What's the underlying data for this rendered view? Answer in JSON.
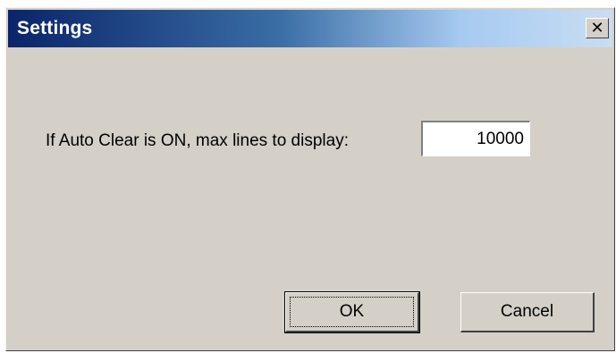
{
  "window": {
    "title": "Settings"
  },
  "form": {
    "prompt": "If Auto Clear is ON, max lines to display:",
    "max_lines_value": "10000"
  },
  "buttons": {
    "ok_label": "OK",
    "cancel_label": "Cancel"
  },
  "icons": {
    "close": "close-icon"
  },
  "colors": {
    "titlebar_start": "#0a246a",
    "titlebar_end": "#c9ddf3",
    "face": "#d4d0c8"
  }
}
